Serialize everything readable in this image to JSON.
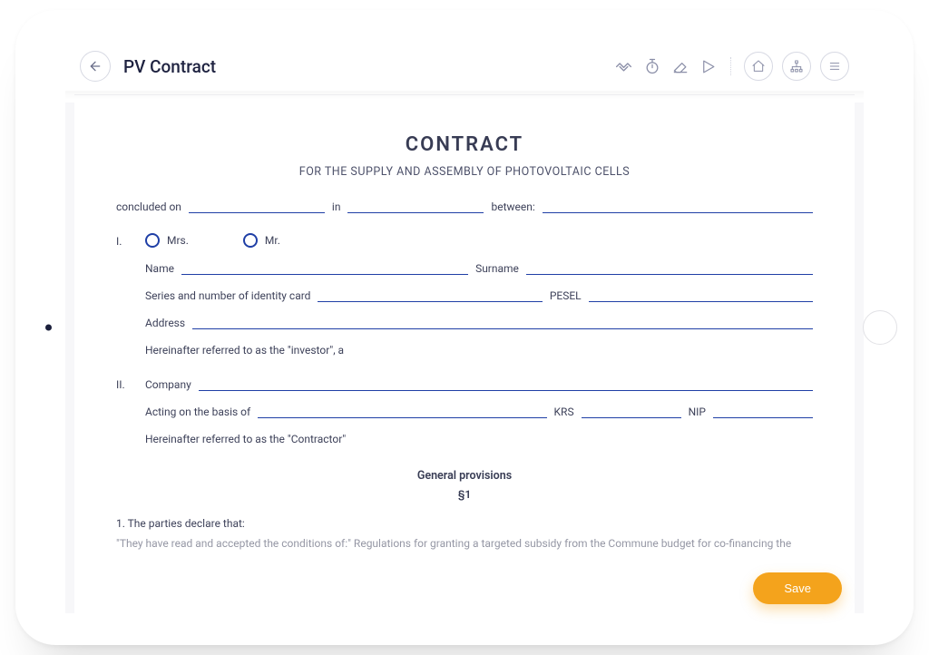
{
  "appbar": {
    "title": "PV Contract"
  },
  "doc": {
    "heading": "CONTRACT",
    "subtitle": "FOR THE SUPPLY AND ASSEMBLY OF PHOTOVOLTAIC CELLS",
    "line_concluded": {
      "concluded_on": "concluded on",
      "in": "in",
      "between": "between:"
    },
    "party1": {
      "roman": "I.",
      "radio_mrs": "Mrs.",
      "radio_mr": "Mr.",
      "name_label": "Name",
      "surname_label": "Surname",
      "idcard_label": "Series and number of identity card",
      "pesel_label": "PESEL",
      "address_label": "Address",
      "hereafter": "Hereinafter referred to as the \"investor\", a"
    },
    "party2": {
      "roman": "II.",
      "company_label": "Company",
      "acting_label": "Acting on the basis of",
      "krs_label": "KRS",
      "nip_label": "NIP",
      "hereafter": "Hereinafter referred to as the \"Contractor\""
    },
    "general_provisions": {
      "title": "General provisions",
      "para": "§1",
      "point1": "1. The parties declare that:",
      "point1_text": "\"They have read and accepted the conditions of:\" Regulations for granting a targeted subsidy from the Commune budget for co-financing the"
    }
  },
  "actions": {
    "save": "Save"
  }
}
